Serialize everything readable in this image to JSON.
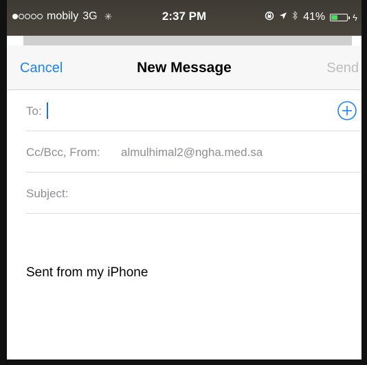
{
  "status_bar": {
    "carrier": "mobily",
    "network": "3G",
    "time": "2:37 PM",
    "battery_percent_label": "41%",
    "battery_level": 0.41,
    "signal_bars_filled": 1,
    "signal_bars_total": 5,
    "icons": [
      "activity-spinner-icon",
      "rotation-lock-icon",
      "location-arrow-icon",
      "bluetooth-icon",
      "battery-icon",
      "charging-bolt-icon"
    ]
  },
  "nav": {
    "cancel_label": "Cancel",
    "title": "New Message",
    "send_label": "Send"
  },
  "fields": {
    "to_label": "To:",
    "cc_bcc_from_label": "Cc/Bcc, From:",
    "from_address": "almulhimal2@ngha.med.sa",
    "subject_label": "Subject:"
  },
  "body": {
    "signature": "Sent from my iPhone"
  },
  "colors": {
    "accent": "#1a82fb",
    "disabled": "#bdbdbd",
    "placeholder": "#8e8e93",
    "battery_fill": "#4cd964"
  }
}
